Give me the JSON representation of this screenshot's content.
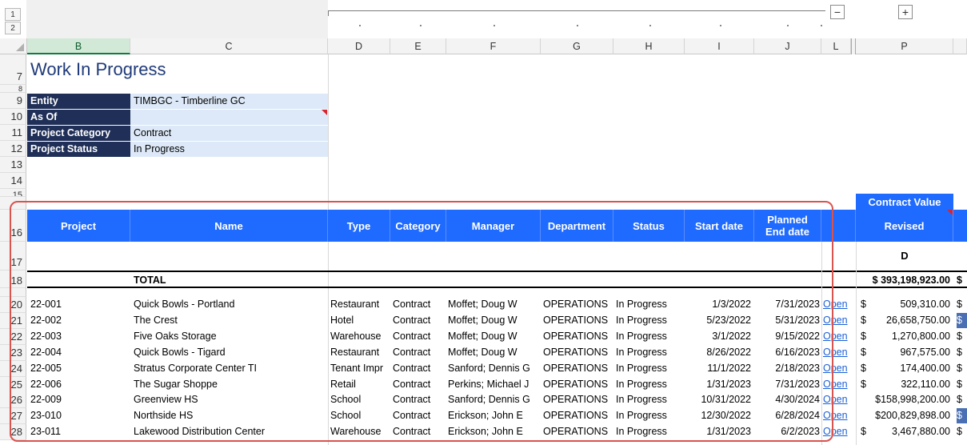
{
  "outline": {
    "levels": [
      "1",
      "2"
    ],
    "collapse_symbol": "−",
    "expand_symbol": "+"
  },
  "columns": [
    {
      "key": "B",
      "label": "B",
      "selected": true
    },
    {
      "key": "C",
      "label": "C"
    },
    {
      "key": "D",
      "label": "D"
    },
    {
      "key": "E",
      "label": "E"
    },
    {
      "key": "F",
      "label": "F"
    },
    {
      "key": "G",
      "label": "G"
    },
    {
      "key": "H",
      "label": "H"
    },
    {
      "key": "I",
      "label": "I"
    },
    {
      "key": "J",
      "label": "J"
    },
    {
      "key": "L",
      "label": "L"
    },
    {
      "key": "P",
      "label": "P"
    }
  ],
  "row_numbers": {
    "title": "7",
    "hidden8": "8",
    "entity": "9",
    "asof": "10",
    "cat": "11",
    "status": "12",
    "r13": "13",
    "r14": "14",
    "r15": "15",
    "header": "16",
    "r17": "17",
    "total": "18"
  },
  "title": "Work In Progress",
  "params": [
    {
      "label": "Entity",
      "value": "TIMBGC - Timberline GC"
    },
    {
      "label": "As Of",
      "value": ""
    },
    {
      "label": "Project Category",
      "value": "Contract"
    },
    {
      "label": "Project Status",
      "value": "In Progress"
    }
  ],
  "table": {
    "group_header": "Contract Value",
    "headers": {
      "project": "Project",
      "name": "Name",
      "type": "Type",
      "category": "Category",
      "manager": "Manager",
      "department": "Department",
      "status": "Status",
      "start": "Start date",
      "end": "Planned\nEnd date",
      "revised": "Revised"
    },
    "revised_code": "D",
    "total_label": "TOTAL",
    "total_value": "$ 393,198,923.00",
    "total_trailing": "$",
    "link_text": "Open",
    "rows": [
      {
        "row": "20",
        "project": "22-001",
        "name": "Quick Bowls - Portland",
        "type": "Restaurant",
        "category": "Contract",
        "manager": "Moffet; Doug W",
        "department": "OPERATIONS",
        "status": "In Progress",
        "start": "1/3/2022",
        "end": "7/31/2023",
        "cur": "$",
        "revised": "509,310.00",
        "tail": "$"
      },
      {
        "row": "21",
        "project": "22-002",
        "name": "The Crest",
        "type": "Hotel",
        "category": "Contract",
        "manager": "Moffet; Doug W",
        "department": "OPERATIONS",
        "status": "In Progress",
        "start": "5/23/2022",
        "end": "5/31/2023",
        "cur": "$",
        "revised": "26,658,750.00",
        "tail": "$"
      },
      {
        "row": "22",
        "project": "22-003",
        "name": "Five Oaks Storage",
        "type": "Warehouse",
        "category": "Contract",
        "manager": "Moffet; Doug W",
        "department": "OPERATIONS",
        "status": "In Progress",
        "start": "3/1/2022",
        "end": "9/15/2022",
        "cur": "$",
        "revised": "1,270,800.00",
        "tail": "$"
      },
      {
        "row": "23",
        "project": "22-004",
        "name": "Quick Bowls - Tigard",
        "type": "Restaurant",
        "category": "Contract",
        "manager": "Moffet; Doug W",
        "department": "OPERATIONS",
        "status": "In Progress",
        "start": "8/26/2022",
        "end": "6/16/2023",
        "cur": "$",
        "revised": "967,575.00",
        "tail": "$"
      },
      {
        "row": "24",
        "project": "22-005",
        "name": "Stratus Corporate Center TI",
        "type": "Tenant Impr",
        "category": "Contract",
        "manager": "Sanford; Dennis G",
        "department": "OPERATIONS",
        "status": "In Progress",
        "start": "11/1/2022",
        "end": "2/18/2023",
        "cur": "$",
        "revised": "174,400.00",
        "tail": "$"
      },
      {
        "row": "25",
        "project": "22-006",
        "name": "The Sugar Shoppe",
        "type": "Retail",
        "category": "Contract",
        "manager": "Perkins; Michael J",
        "department": "OPERATIONS",
        "status": "In Progress",
        "start": "1/31/2023",
        "end": "7/31/2023",
        "cur": "$",
        "revised": "322,110.00",
        "tail": "$"
      },
      {
        "row": "26",
        "project": "22-009",
        "name": "Greenview HS",
        "type": "School",
        "category": "Contract",
        "manager": "Sanford; Dennis G",
        "department": "OPERATIONS",
        "status": "In Progress",
        "start": "10/31/2022",
        "end": "4/30/2024",
        "cur": "",
        "revised": "$158,998,200.00",
        "tail": "$"
      },
      {
        "row": "27",
        "project": "23-010",
        "name": "Northside HS",
        "type": "School",
        "category": "Contract",
        "manager": "Erickson; John E",
        "department": "OPERATIONS",
        "status": "In Progress",
        "start": "12/30/2022",
        "end": "6/28/2024",
        "cur": "",
        "revised": "$200,829,898.00",
        "tail": "$"
      },
      {
        "row": "28",
        "project": "23-011",
        "name": "Lakewood Distribution Center",
        "type": "Warehouse",
        "category": "Contract",
        "manager": "Erickson; John E",
        "department": "OPERATIONS",
        "status": "In Progress",
        "start": "1/31/2023",
        "end": "6/2/2023",
        "cur": "$",
        "revised": "3,467,880.00",
        "tail": "$"
      }
    ]
  },
  "colors": {
    "header_blue": "#1f6bff",
    "label_navy": "#1f2f57",
    "value_fill": "#dde9f8",
    "highlight_box": "#d9534f",
    "selected_col": "#107c41"
  }
}
